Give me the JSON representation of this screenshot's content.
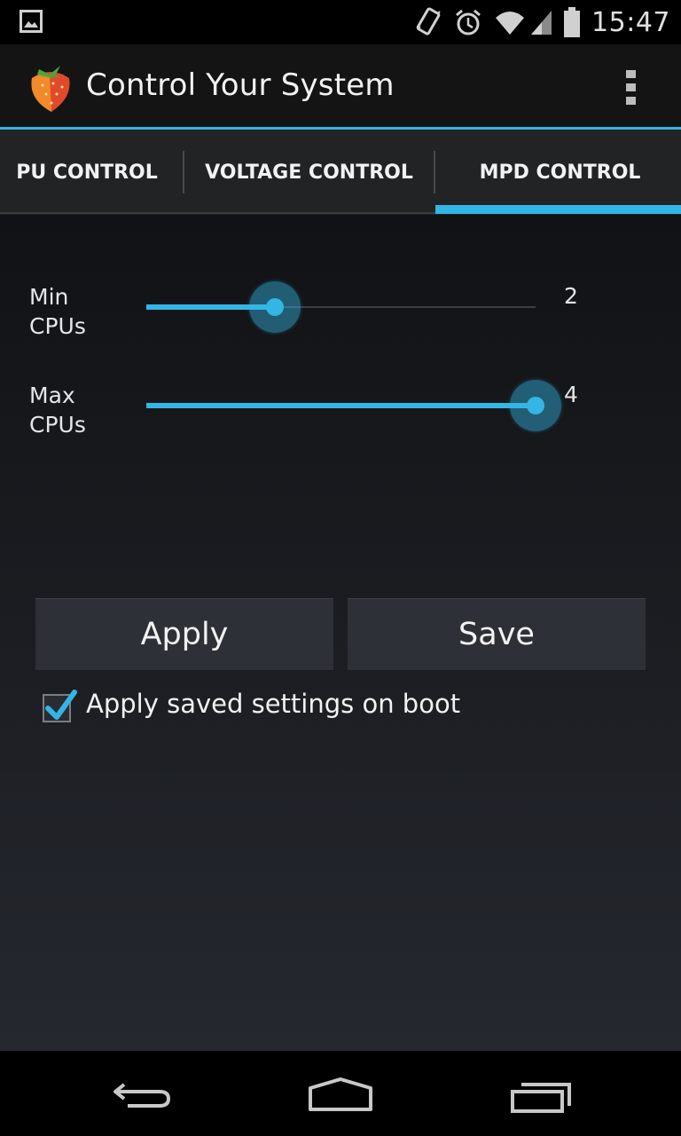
{
  "status_bar": {
    "time": "15:47",
    "icons": [
      "image-icon",
      "vibrate-icon",
      "alarm-icon",
      "wifi-icon",
      "signal-icon",
      "battery-icon"
    ]
  },
  "action_bar": {
    "title": "Control Your System",
    "app_icon": "strawberry-icon",
    "overflow_icon": "overflow-menu-icon"
  },
  "tabs": [
    {
      "label": "PU CONTROL",
      "selected": false
    },
    {
      "label": "VOLTAGE CONTROL",
      "selected": false
    },
    {
      "label": "MPD CONTROL",
      "selected": true
    }
  ],
  "accent_color": "#33b5e5",
  "sliders": [
    {
      "label_line1": "Min",
      "label_line2": "CPUs",
      "value": "2",
      "level": 0.33
    },
    {
      "label_line1": "Max",
      "label_line2": "CPUs",
      "value": "4",
      "level": 1.0
    }
  ],
  "buttons": {
    "apply": "Apply",
    "save": "Save"
  },
  "boot_checkbox": {
    "label": "Apply saved settings on boot",
    "checked": true
  },
  "nav_bar": {
    "icons": [
      "back-icon",
      "home-icon",
      "recent-apps-icon"
    ]
  }
}
